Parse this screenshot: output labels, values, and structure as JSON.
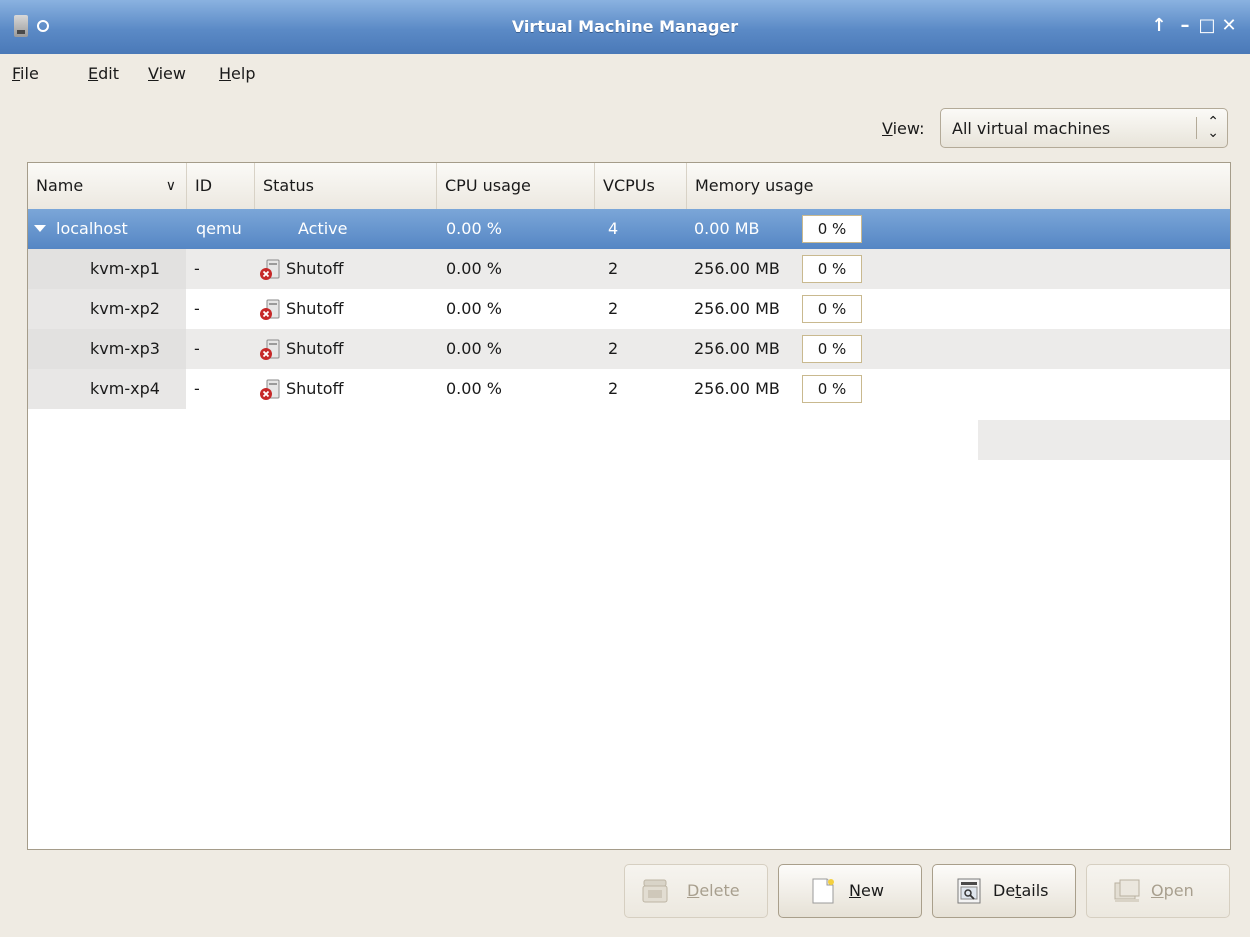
{
  "window": {
    "title": "Virtual Machine Manager"
  },
  "menu": [
    {
      "mnemonic": "F",
      "rest": "ile"
    },
    {
      "mnemonic": "E",
      "rest": "dit"
    },
    {
      "mnemonic": "V",
      "rest": "iew"
    },
    {
      "mnemonic": "H",
      "rest": "elp"
    }
  ],
  "view_filter": {
    "label_mnemonic": "V",
    "label_rest": "iew:",
    "selected": "All virtual machines"
  },
  "columns": [
    "Name",
    "ID",
    "Status",
    "CPU usage",
    "VCPUs",
    "Memory usage"
  ],
  "host": {
    "name": "localhost",
    "id": "qemu",
    "status": "Active",
    "cpu": "0.00 %",
    "vcpus": "4",
    "memory": "0.00 MB",
    "memory_pct": "0 %"
  },
  "vms": [
    {
      "name": "kvm-xp1",
      "id": "-",
      "status": "Shutoff",
      "cpu": "0.00 %",
      "vcpus": "2",
      "memory": "256.00 MB",
      "memory_pct": "0 %"
    },
    {
      "name": "kvm-xp2",
      "id": "-",
      "status": "Shutoff",
      "cpu": "0.00 %",
      "vcpus": "2",
      "memory": "256.00 MB",
      "memory_pct": "0 %"
    },
    {
      "name": "kvm-xp3",
      "id": "-",
      "status": "Shutoff",
      "cpu": "0.00 %",
      "vcpus": "2",
      "memory": "256.00 MB",
      "memory_pct": "0 %"
    },
    {
      "name": "kvm-xp4",
      "id": "-",
      "status": "Shutoff",
      "cpu": "0.00 %",
      "vcpus": "2",
      "memory": "256.00 MB",
      "memory_pct": "0 %"
    }
  ],
  "buttons": {
    "delete": {
      "mnemonic": "D",
      "rest": "elete",
      "enabled": false
    },
    "new": {
      "mnemonic": "N",
      "rest": "ew",
      "enabled": true
    },
    "details": {
      "pre": "De",
      "mnemonic": "t",
      "rest": "ails",
      "enabled": true
    },
    "open": {
      "mnemonic": "O",
      "rest": "pen",
      "enabled": false
    }
  },
  "colors": {
    "selection": "#5586c4",
    "titlebar": "#5b8ac6",
    "window_bg": "#efebe3",
    "alt_row": "#ecebea"
  },
  "icons": {
    "status_shutoff": "shutoff-icon",
    "delete": "delete-icon",
    "new": "new-vm-icon",
    "details": "details-icon",
    "open": "open-icon"
  }
}
